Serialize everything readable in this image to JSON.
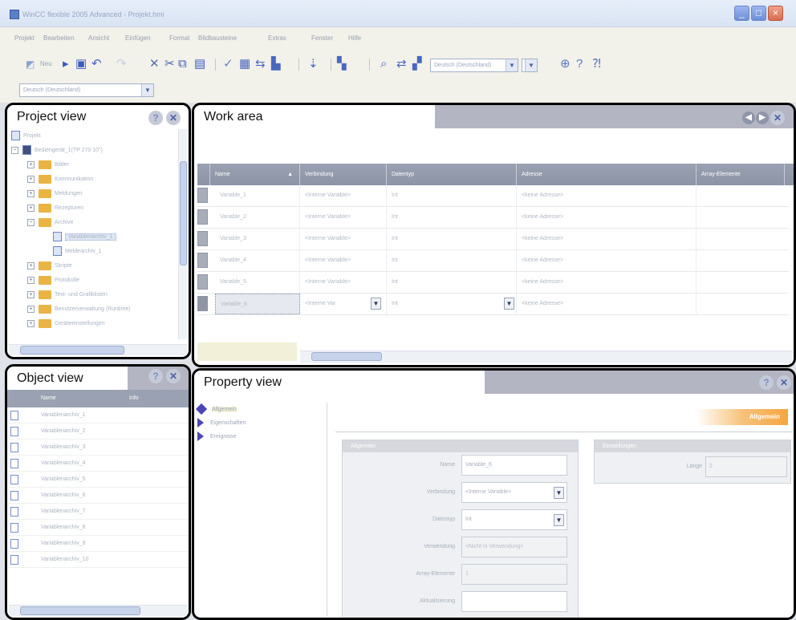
{
  "window": {
    "title": "WinCC flexible 2005 Advanced - Projekt.hmi",
    "buttons": {
      "minimize": "_",
      "maximize": "□",
      "close": "×"
    }
  },
  "menu": [
    "Projekt",
    "Bearbeiten",
    "Ansicht",
    "Einfügen",
    "Format",
    "Bildbausteine",
    "Extras",
    "Fenster",
    "Hilfe"
  ],
  "toolbar": {
    "new_label": "Neu",
    "icons": [
      "new-icon",
      "open-icon",
      "save-icon",
      "undo-icon",
      "redo-icon",
      "delete-icon",
      "cut-icon",
      "copy-icon",
      "paste-icon",
      "check-icon",
      "compile-icon",
      "transfer-icon",
      "simulate-icon",
      "language-icon",
      "font-icon",
      "search-icon",
      "replace-icon",
      "crossref-icon",
      "help-icon",
      "whats-this-icon"
    ],
    "language_combo": "Deutsch (Deutschland)",
    "font_combo": "Deutsch (Deutschland)"
  },
  "project_view": {
    "title": "Project view",
    "tree": [
      {
        "label": "Projekt",
        "level": 0,
        "toggle": "",
        "icon": "project-icon"
      },
      {
        "label": "Bediengerät_1(TP 270 10\")",
        "level": 0,
        "toggle": "−",
        "icon": "device-icon"
      },
      {
        "label": "Bilder",
        "level": 1,
        "toggle": "+",
        "icon": "folder-icon"
      },
      {
        "label": "Kommunikation",
        "level": 1,
        "toggle": "+",
        "icon": "folder-icon"
      },
      {
        "label": "Meldungen",
        "level": 1,
        "toggle": "+",
        "icon": "folder-icon"
      },
      {
        "label": "Rezepturen",
        "level": 1,
        "toggle": "+",
        "icon": "folder-icon"
      },
      {
        "label": "Archive",
        "level": 1,
        "toggle": "−",
        "icon": "folder-icon"
      },
      {
        "label": "Variablenarchiv_1",
        "level": 2,
        "toggle": "",
        "icon": "archive-icon",
        "selected": true
      },
      {
        "label": "Meldearchiv_1",
        "level": 2,
        "toggle": "",
        "icon": "archive-icon"
      },
      {
        "label": "Skripte",
        "level": 1,
        "toggle": "+",
        "icon": "folder-icon"
      },
      {
        "label": "Protokolle",
        "level": 1,
        "toggle": "+",
        "icon": "folder-icon"
      },
      {
        "label": "Text- und Grafiklisten",
        "level": 1,
        "toggle": "+",
        "icon": "folder-icon"
      },
      {
        "label": "Benutzerverwaltung (Runtime)",
        "level": 1,
        "toggle": "+",
        "icon": "folder-icon"
      },
      {
        "label": "Geräteeinstellungen",
        "level": 1,
        "toggle": "+",
        "icon": "folder-icon"
      }
    ]
  },
  "work_area": {
    "title": "Work area",
    "columns": [
      "Name",
      "Verbindung",
      "Datentyp",
      "Adresse",
      "Array-Elemente"
    ],
    "rows": [
      {
        "name": "Variable_1",
        "connection": "<Interne Variable>",
        "type": "Int",
        "address": "<keine Adresse>"
      },
      {
        "name": "Variable_2",
        "connection": "<Interne Variable>",
        "type": "Int",
        "address": "<keine Adresse>"
      },
      {
        "name": "Variable_3",
        "connection": "<Interne Variable>",
        "type": "Int",
        "address": "<keine Adresse>"
      },
      {
        "name": "Variable_4",
        "connection": "<Interne Variable>",
        "type": "Int",
        "address": "<keine Adresse>"
      },
      {
        "name": "Variable_5",
        "connection": "<Interne Variable>",
        "type": "Int",
        "address": "<keine Adresse>"
      },
      {
        "name": "Variable_6",
        "connection": "<Interne Var",
        "type": "Int",
        "address": "<keine Adresse>"
      }
    ]
  },
  "object_view": {
    "title": "Object view",
    "columns": [
      "Name",
      "Info"
    ],
    "items": [
      "Variablenarchiv_1",
      "Variablenarchiv_2",
      "Variablenarchiv_3",
      "Variablenarchiv_4",
      "Variablenarchiv_5",
      "Variablenarchiv_6",
      "Variablenarchiv_7",
      "Variablenarchiv_8",
      "Variablenarchiv_9",
      "Variablenarchiv_10"
    ]
  },
  "property_view": {
    "title": "Property view",
    "nav": [
      "Allgemein",
      "Eigenschaften",
      "Ereignisse"
    ],
    "section_label": "Allgemein",
    "group_general": "Allgemein",
    "group_settings": "Einstellungen",
    "fields": [
      {
        "label": "Name",
        "value": "Variable_6",
        "readonly": false,
        "dropdown": false
      },
      {
        "label": "Verbindung",
        "value": "<Interne Variable>",
        "readonly": false,
        "dropdown": true
      },
      {
        "label": "Datentyp",
        "value": "Int",
        "readonly": false,
        "dropdown": true
      },
      {
        "label": "Verwendung",
        "value": "<Nicht in Verwendung>",
        "readonly": true,
        "dropdown": false
      },
      {
        "label": "Array-Elemente",
        "value": "1",
        "readonly": true,
        "dropdown": false
      },
      {
        "label": "Aktualisierung",
        "value": "",
        "readonly": false,
        "dropdown": false
      }
    ],
    "settings_fields": [
      {
        "label": "Länge",
        "value": "2"
      }
    ]
  },
  "colors": {
    "panel_bar": "#b3b5c3",
    "grid_header": "#9aa1b2",
    "nav_triangle": "#4a46b6",
    "folder": "#eab445"
  }
}
